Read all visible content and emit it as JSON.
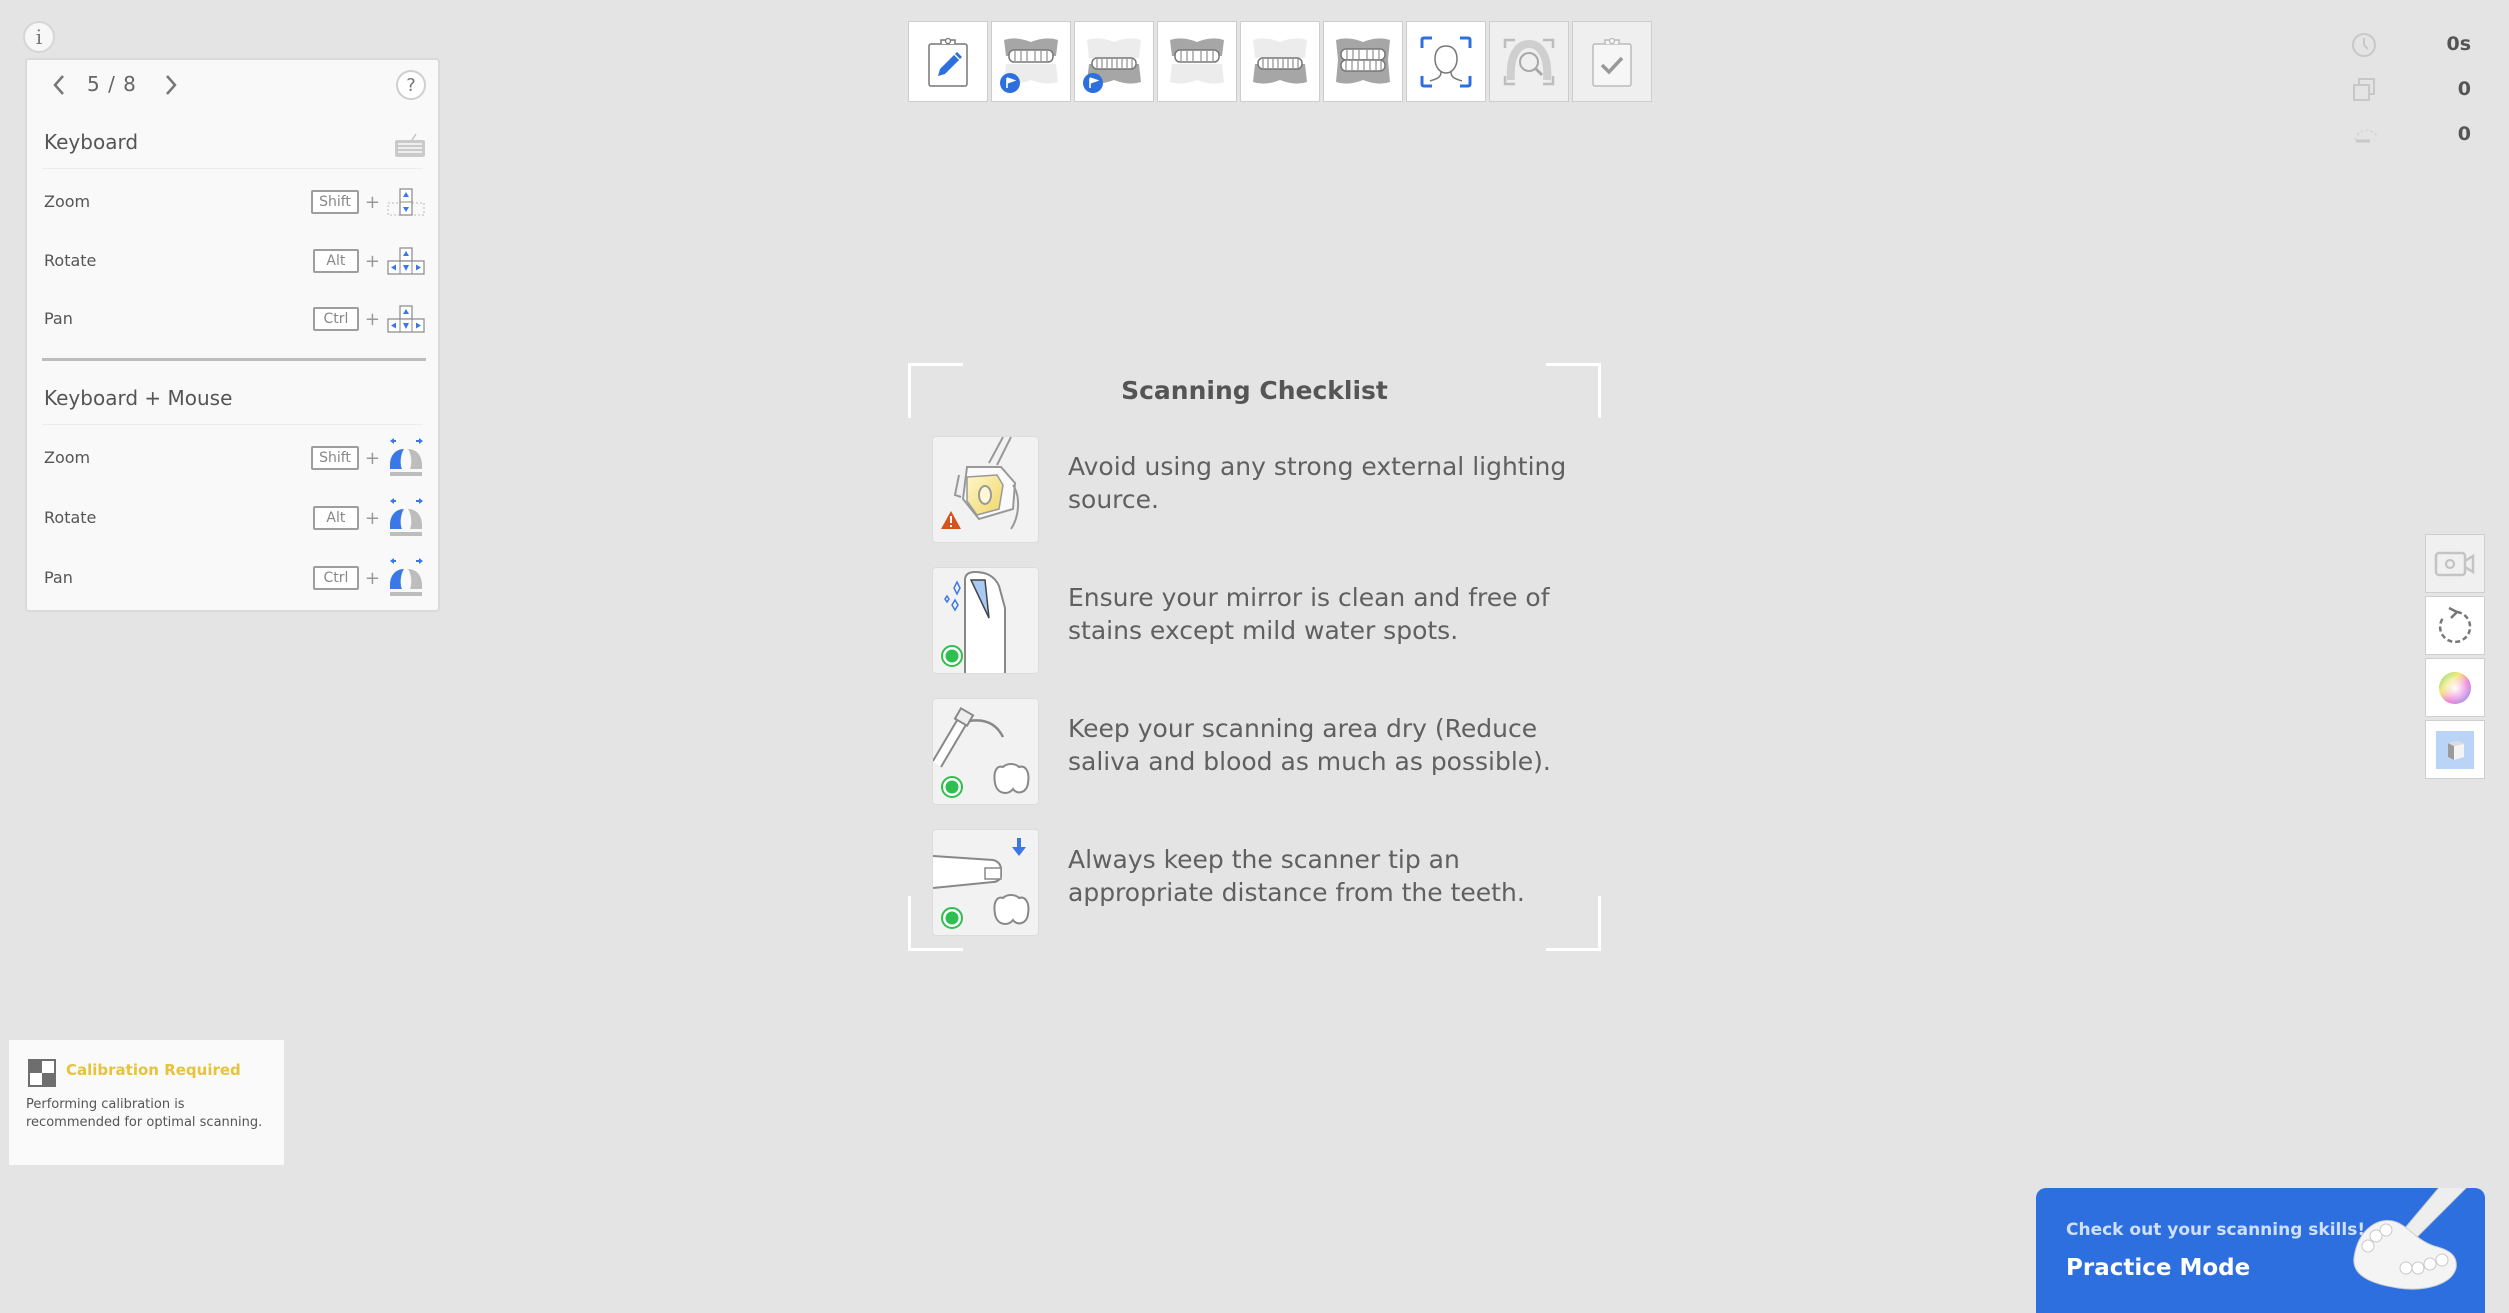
{
  "info_button": {
    "icon": "info-icon",
    "glyph": "i"
  },
  "shortcuts_panel": {
    "pager": {
      "current": 5,
      "total": 8,
      "label": "5 / 8",
      "prev_glyph": "‹",
      "next_glyph": "›",
      "help_glyph": "?"
    },
    "sections": [
      {
        "title": "Keyboard",
        "icon": "keyboard-icon",
        "rows": [
          {
            "action": "Zoom",
            "key": "Shift",
            "plus": "+",
            "input_icon": "arrow-up-down-keys-icon"
          },
          {
            "action": "Rotate",
            "key": "Alt",
            "plus": "+",
            "input_icon": "arrow-keys-icon"
          },
          {
            "action": "Pan",
            "key": "Ctrl",
            "plus": "+",
            "input_icon": "arrow-keys-icon"
          }
        ]
      },
      {
        "title": "Keyboard + Mouse",
        "rows": [
          {
            "action": "Zoom",
            "key": "Shift",
            "plus": "+",
            "input_icon": "mouse-left-drag-icon"
          },
          {
            "action": "Rotate",
            "key": "Alt",
            "plus": "+",
            "input_icon": "mouse-left-drag-icon"
          },
          {
            "action": "Pan",
            "key": "Ctrl",
            "plus": "+",
            "input_icon": "mouse-left-drag-icon"
          }
        ]
      }
    ]
  },
  "toolbar": {
    "steps": [
      {
        "name": "patient-info",
        "icon": "clipboard-edit-icon",
        "state": "active"
      },
      {
        "name": "maxilla-scan",
        "icon": "upper-jaw-icon",
        "state": "flagged"
      },
      {
        "name": "mandible-scan",
        "icon": "lower-jaw-icon",
        "state": "flagged"
      },
      {
        "name": "maxilla-prep",
        "icon": "upper-jaw-icon",
        "state": "active"
      },
      {
        "name": "mandible-prep",
        "icon": "lower-jaw-icon",
        "state": "active"
      },
      {
        "name": "occlusion",
        "icon": "bite-icon",
        "state": "active"
      },
      {
        "name": "face-scan",
        "icon": "face-scan-icon",
        "state": "active"
      },
      {
        "name": "analysis",
        "icon": "arch-inspect-icon",
        "state": "disabled"
      },
      {
        "name": "complete",
        "icon": "clipboard-check-icon",
        "state": "disabled"
      }
    ]
  },
  "stats": [
    {
      "icon": "clock-icon",
      "value": "0s"
    },
    {
      "icon": "layers-icon",
      "value": "0"
    },
    {
      "icon": "speed-gauge-icon",
      "value": "0"
    }
  ],
  "side_tools": [
    {
      "name": "video-record",
      "icon": "video-camera-icon",
      "state": "disabled"
    },
    {
      "name": "reset-view",
      "icon": "rotate-reset-icon",
      "state": "active"
    },
    {
      "name": "color-toggle",
      "icon": "color-wheel-icon",
      "state": "active"
    },
    {
      "name": "mono-toggle",
      "icon": "cube-icon",
      "state": "selected"
    }
  ],
  "checklist": {
    "title": "Scanning Checklist",
    "items": [
      {
        "text": "Avoid using any strong external lighting source.",
        "icon": "dental-lamp-icon",
        "status": "warning"
      },
      {
        "text": "Ensure your mirror is clean and free of stains except mild water spots.",
        "icon": "scanner-mirror-icon",
        "status": "ok"
      },
      {
        "text": "Keep your scanning area dry (Reduce saliva and blood as much as possible).",
        "icon": "air-syringe-icon",
        "status": "ok"
      },
      {
        "text": "Always keep the scanner tip an appropriate distance from the teeth.",
        "icon": "scanner-tip-distance-icon",
        "status": "ok"
      }
    ]
  },
  "calibration": {
    "title": "Calibration Required",
    "message": "Performing calibration is recommended for optimal scanning.",
    "title_color": "#e6c33a"
  },
  "practice": {
    "subtitle": "Check out your scanning skills!",
    "title": "Practice Mode",
    "bg_color": "#2e6fe0"
  },
  "colors": {
    "accent": "#2e6fe0",
    "ok": "#2fbf4f",
    "warning": "#d4531e",
    "background": "#e4e4e4"
  }
}
